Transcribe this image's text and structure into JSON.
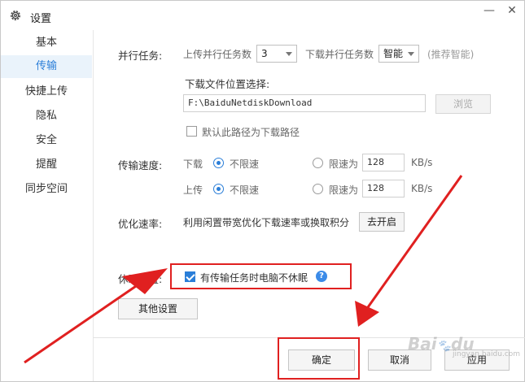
{
  "window": {
    "title": "设置",
    "minimize_glyph": "—",
    "close_glyph": "✕"
  },
  "sidebar": {
    "items": [
      {
        "label": "基本",
        "active": false
      },
      {
        "label": "传输",
        "active": true
      },
      {
        "label": "快捷上传",
        "active": false
      },
      {
        "label": "隐私",
        "active": false
      },
      {
        "label": "安全",
        "active": false
      },
      {
        "label": "提醒",
        "active": false
      },
      {
        "label": "同步空间",
        "active": false
      }
    ]
  },
  "parallel": {
    "section_label": "并行任务:",
    "upload_label": "上传并行任务数",
    "upload_value": "3",
    "download_label": "下载并行任务数",
    "download_value": "智能",
    "hint": "(推荐智能)"
  },
  "download_location": {
    "label": "下载文件位置选择:",
    "path": "F:\\BaiduNetdiskDownload",
    "browse_label": "浏览",
    "default_checkbox_label": "默认此路径为下载路径",
    "default_checked": false
  },
  "speed": {
    "section_label": "传输速度:",
    "download_label": "下载",
    "upload_label": "上传",
    "unlimited_label": "不限速",
    "limit_label": "限速为",
    "download_limit_value": "128",
    "upload_limit_value": "128",
    "unit": "KB/s"
  },
  "optimize": {
    "section_label": "优化速率:",
    "text": "利用闲置带宽优化下载速率或换取积分",
    "button_label": "去开启"
  },
  "sleep": {
    "section_label": "休眠设置:",
    "checkbox_label": "有传输任务时电脑不休眠",
    "checked": true,
    "help_glyph": "?"
  },
  "other_settings_label": "其他设置",
  "footer": {
    "ok_label": "确定",
    "cancel_label": "取消",
    "apply_label": "应用"
  },
  "watermark": {
    "text": "Bai",
    "glyph": "du",
    "sub": "jingyan.baidu.com"
  },
  "colors": {
    "accent": "#2a7ed8",
    "annotation_red": "#e02020"
  }
}
